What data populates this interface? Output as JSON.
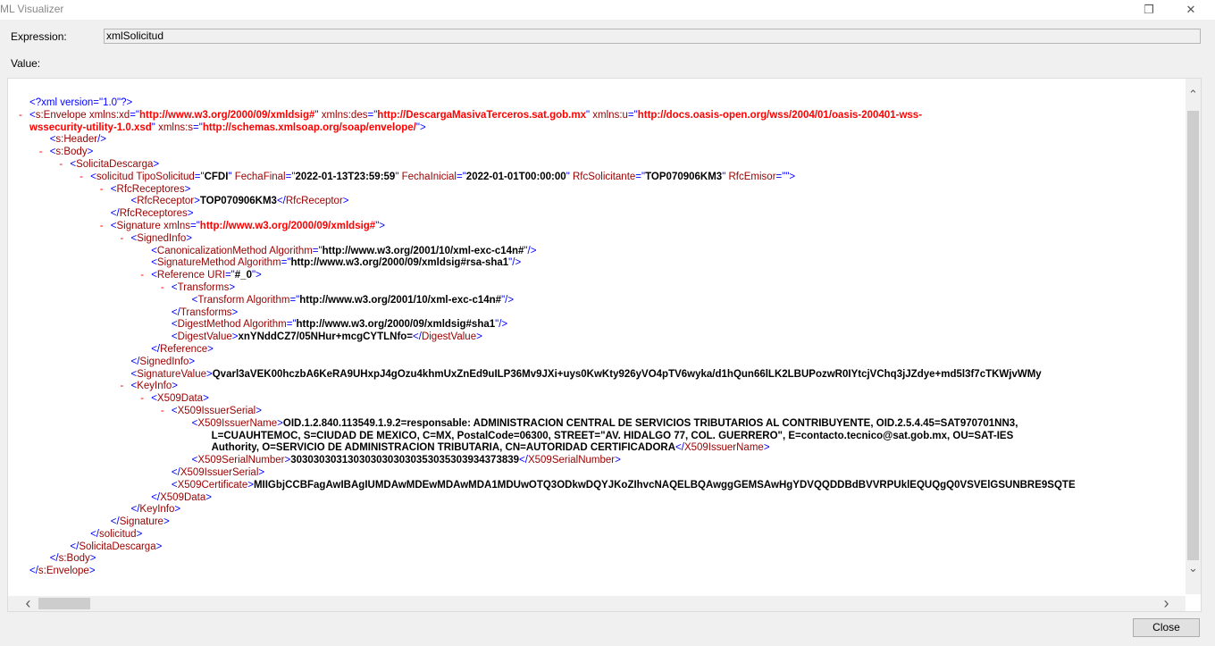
{
  "window": {
    "title": "ML Visualizer",
    "restore_glyph": "❐",
    "close_glyph": "✕"
  },
  "expression": {
    "label": "Expression:",
    "value": "xmlSolicitud"
  },
  "value_label": "Value:",
  "close_button": "Close",
  "xml_lines": [
    {
      "indent": 0,
      "minus": false,
      "parts": [
        [
          "t",
          "<?xml version=\"1.0\"?>"
        ]
      ]
    },
    {
      "indent": 0,
      "minus": true,
      "parts": [
        [
          "t",
          "<"
        ],
        [
          "n",
          "s:Envelope"
        ],
        [
          "a",
          " xmlns:xd"
        ],
        [
          "t",
          "=\""
        ],
        [
          "v",
          "http://www.w3.org/2000/09/xmldsig#"
        ],
        [
          "t",
          "\""
        ],
        [
          "a",
          " xmlns:des"
        ],
        [
          "t",
          "=\""
        ],
        [
          "v",
          "http://DescargaMasivaTerceros.sat.gob.mx"
        ],
        [
          "t",
          "\""
        ],
        [
          "a",
          " xmlns:u"
        ],
        [
          "t",
          "=\""
        ],
        [
          "v",
          "http://docs.oasis-open.org/wss/2004/01/oasis-200401-wss-"
        ]
      ]
    },
    {
      "indent": 0,
      "minus": false,
      "parts": [
        [
          "v",
          "wssecurity-utility-1.0.xsd"
        ],
        [
          "t",
          "\""
        ],
        [
          "a",
          " xmlns:s"
        ],
        [
          "t",
          "=\""
        ],
        [
          "v",
          "http://schemas.xmlsoap.org/soap/envelope/"
        ],
        [
          "t",
          "\">"
        ]
      ]
    },
    {
      "indent": 1,
      "minus": false,
      "parts": [
        [
          "t",
          "<"
        ],
        [
          "n",
          "s:Header"
        ],
        [
          "t",
          "/>"
        ]
      ]
    },
    {
      "indent": 1,
      "minus": true,
      "parts": [
        [
          "t",
          "<"
        ],
        [
          "n",
          "s:Body"
        ],
        [
          "t",
          ">"
        ]
      ]
    },
    {
      "indent": 2,
      "minus": true,
      "parts": [
        [
          "t",
          "<"
        ],
        [
          "n",
          "SolicitaDescarga"
        ],
        [
          "t",
          ">"
        ]
      ]
    },
    {
      "indent": 3,
      "minus": true,
      "parts": [
        [
          "t",
          "<"
        ],
        [
          "n",
          "solicitud"
        ],
        [
          "a",
          " TipoSolicitud"
        ],
        [
          "t",
          "=\""
        ],
        [
          "k",
          "CFDI"
        ],
        [
          "t",
          "\""
        ],
        [
          "a",
          " FechaFinal"
        ],
        [
          "t",
          "=\""
        ],
        [
          "k",
          "2022-01-13T23:59:59"
        ],
        [
          "t",
          "\""
        ],
        [
          "a",
          " FechaInicial"
        ],
        [
          "t",
          "=\""
        ],
        [
          "k",
          "2022-01-01T00:00:00"
        ],
        [
          "t",
          "\""
        ],
        [
          "a",
          " RfcSolicitante"
        ],
        [
          "t",
          "=\""
        ],
        [
          "k",
          "TOP070906KM3"
        ],
        [
          "t",
          "\""
        ],
        [
          "a",
          " RfcEmisor"
        ],
        [
          "t",
          "=\"\">"
        ]
      ]
    },
    {
      "indent": 4,
      "minus": true,
      "parts": [
        [
          "t",
          "<"
        ],
        [
          "n",
          "RfcReceptores"
        ],
        [
          "t",
          ">"
        ]
      ]
    },
    {
      "indent": 5,
      "minus": false,
      "parts": [
        [
          "t",
          "<"
        ],
        [
          "n",
          "RfcReceptor"
        ],
        [
          "t",
          ">"
        ],
        [
          "k",
          "TOP070906KM3"
        ],
        [
          "t",
          "</"
        ],
        [
          "n",
          "RfcReceptor"
        ],
        [
          "t",
          ">"
        ]
      ]
    },
    {
      "indent": 4,
      "minus": false,
      "parts": [
        [
          "t",
          "</"
        ],
        [
          "n",
          "RfcReceptores"
        ],
        [
          "t",
          ">"
        ]
      ]
    },
    {
      "indent": 4,
      "minus": true,
      "parts": [
        [
          "t",
          "<"
        ],
        [
          "n",
          "Signature"
        ],
        [
          "a",
          " xmlns"
        ],
        [
          "t",
          "=\""
        ],
        [
          "v",
          "http://www.w3.org/2000/09/xmldsig#"
        ],
        [
          "t",
          "\">"
        ]
      ]
    },
    {
      "indent": 5,
      "minus": true,
      "parts": [
        [
          "t",
          "<"
        ],
        [
          "n",
          "SignedInfo"
        ],
        [
          "t",
          ">"
        ]
      ]
    },
    {
      "indent": 6,
      "minus": false,
      "parts": [
        [
          "t",
          "<"
        ],
        [
          "n",
          "CanonicalizationMethod"
        ],
        [
          "a",
          " Algorithm"
        ],
        [
          "t",
          "=\""
        ],
        [
          "k",
          "http://www.w3.org/2001/10/xml-exc-c14n#"
        ],
        [
          "t",
          "\"/>"
        ]
      ]
    },
    {
      "indent": 6,
      "minus": false,
      "parts": [
        [
          "t",
          "<"
        ],
        [
          "n",
          "SignatureMethod"
        ],
        [
          "a",
          " Algorithm"
        ],
        [
          "t",
          "=\""
        ],
        [
          "k",
          "http://www.w3.org/2000/09/xmldsig#rsa-sha1"
        ],
        [
          "t",
          "\"/>"
        ]
      ]
    },
    {
      "indent": 6,
      "minus": true,
      "parts": [
        [
          "t",
          "<"
        ],
        [
          "n",
          "Reference"
        ],
        [
          "a",
          " URI"
        ],
        [
          "t",
          "=\""
        ],
        [
          "k",
          "#_0"
        ],
        [
          "t",
          "\">"
        ]
      ]
    },
    {
      "indent": 7,
      "minus": true,
      "parts": [
        [
          "t",
          "<"
        ],
        [
          "n",
          "Transforms"
        ],
        [
          "t",
          ">"
        ]
      ]
    },
    {
      "indent": 8,
      "minus": false,
      "parts": [
        [
          "t",
          "<"
        ],
        [
          "n",
          "Transform"
        ],
        [
          "a",
          " Algorithm"
        ],
        [
          "t",
          "=\""
        ],
        [
          "k",
          "http://www.w3.org/2001/10/xml-exc-c14n#"
        ],
        [
          "t",
          "\"/>"
        ]
      ]
    },
    {
      "indent": 7,
      "minus": false,
      "parts": [
        [
          "t",
          "</"
        ],
        [
          "n",
          "Transforms"
        ],
        [
          "t",
          ">"
        ]
      ]
    },
    {
      "indent": 7,
      "minus": false,
      "parts": [
        [
          "t",
          "<"
        ],
        [
          "n",
          "DigestMethod"
        ],
        [
          "a",
          " Algorithm"
        ],
        [
          "t",
          "=\""
        ],
        [
          "k",
          "http://www.w3.org/2000/09/xmldsig#sha1"
        ],
        [
          "t",
          "\"/>"
        ]
      ]
    },
    {
      "indent": 7,
      "minus": false,
      "parts": [
        [
          "t",
          "<"
        ],
        [
          "n",
          "DigestValue"
        ],
        [
          "t",
          ">"
        ],
        [
          "k",
          "xnYNddCZ7/05NHur+mcgCYTLNfo="
        ],
        [
          "t",
          "</"
        ],
        [
          "n",
          "DigestValue"
        ],
        [
          "t",
          ">"
        ]
      ]
    },
    {
      "indent": 6,
      "minus": false,
      "parts": [
        [
          "t",
          "</"
        ],
        [
          "n",
          "Reference"
        ],
        [
          "t",
          ">"
        ]
      ]
    },
    {
      "indent": 5,
      "minus": false,
      "parts": [
        [
          "t",
          "</"
        ],
        [
          "n",
          "SignedInfo"
        ],
        [
          "t",
          ">"
        ]
      ]
    },
    {
      "indent": 5,
      "minus": false,
      "parts": [
        [
          "t",
          "<"
        ],
        [
          "n",
          "SignatureValue"
        ],
        [
          "t",
          ">"
        ],
        [
          "k",
          "Qvarl3aVEK00hczbA6KeRA9UHxpJ4gOzu4khmUxZnEd9uILP36Mv9JXi+uys0KwKty926yVO4pTV6wyka/d1hQun66lLK2LBUPozwR0IYtcjVChq3jJZdye+md5l3f7cTKWjvWMy"
        ]
      ]
    },
    {
      "indent": 5,
      "minus": true,
      "parts": [
        [
          "t",
          "<"
        ],
        [
          "n",
          "KeyInfo"
        ],
        [
          "t",
          ">"
        ]
      ]
    },
    {
      "indent": 6,
      "minus": true,
      "parts": [
        [
          "t",
          "<"
        ],
        [
          "n",
          "X509Data"
        ],
        [
          "t",
          ">"
        ]
      ]
    },
    {
      "indent": 7,
      "minus": true,
      "parts": [
        [
          "t",
          "<"
        ],
        [
          "n",
          "X509IssuerSerial"
        ],
        [
          "t",
          ">"
        ]
      ]
    },
    {
      "indent": 8,
      "minus": false,
      "parts": [
        [
          "t",
          "<"
        ],
        [
          "n",
          "X509IssuerName"
        ],
        [
          "t",
          ">"
        ],
        [
          "k",
          "OID.1.2.840.113549.1.9.2=responsable: ADMINISTRACION CENTRAL DE SERVICIOS TRIBUTARIOS AL CONTRIBUYENTE, OID.2.5.4.45=SAT970701NN3,"
        ]
      ]
    },
    {
      "indent": 8,
      "minus": false,
      "pad": 1,
      "parts": [
        [
          "k",
          "L=CUAUHTEMOC, S=CIUDAD DE MEXICO, C=MX, PostalCode=06300, STREET=\"AV. HIDALGO 77, COL. GUERRERO\", E=contacto.tecnico@sat.gob.mx, OU=SAT-IES"
        ]
      ]
    },
    {
      "indent": 8,
      "minus": false,
      "pad": 1,
      "parts": [
        [
          "k",
          "Authority, O=SERVICIO DE ADMINISTRACION TRIBUTARIA, CN=AUTORIDAD CERTIFICADORA"
        ],
        [
          "t",
          "</"
        ],
        [
          "n",
          "X509IssuerName"
        ],
        [
          "t",
          ">"
        ]
      ]
    },
    {
      "indent": 8,
      "minus": false,
      "parts": [
        [
          "t",
          "<"
        ],
        [
          "n",
          "X509SerialNumber"
        ],
        [
          "t",
          ">"
        ],
        [
          "k",
          "3030303031303030303030353035303934373839"
        ],
        [
          "t",
          "</"
        ],
        [
          "n",
          "X509SerialNumber"
        ],
        [
          "t",
          ">"
        ]
      ]
    },
    {
      "indent": 7,
      "minus": false,
      "parts": [
        [
          "t",
          "</"
        ],
        [
          "n",
          "X509IssuerSerial"
        ],
        [
          "t",
          ">"
        ]
      ]
    },
    {
      "indent": 7,
      "minus": false,
      "parts": [
        [
          "t",
          "<"
        ],
        [
          "n",
          "X509Certificate"
        ],
        [
          "t",
          ">"
        ],
        [
          "k",
          "MIIGbjCCBFagAwIBAgIUMDAwMDEwMDAwMDA1MDUwOTQ3ODkwDQYJKoZIhvcNAQELBQAwggGEMSAwHgYDVQQDDBdBVVRPUklEQUQgQ0VSVElGSUNBRE9SQTE"
        ]
      ]
    },
    {
      "indent": 6,
      "minus": false,
      "parts": [
        [
          "t",
          "</"
        ],
        [
          "n",
          "X509Data"
        ],
        [
          "t",
          ">"
        ]
      ]
    },
    {
      "indent": 5,
      "minus": false,
      "parts": [
        [
          "t",
          "</"
        ],
        [
          "n",
          "KeyInfo"
        ],
        [
          "t",
          ">"
        ]
      ]
    },
    {
      "indent": 4,
      "minus": false,
      "parts": [
        [
          "t",
          "</"
        ],
        [
          "n",
          "Signature"
        ],
        [
          "t",
          ">"
        ]
      ]
    },
    {
      "indent": 3,
      "minus": false,
      "parts": [
        [
          "t",
          "</"
        ],
        [
          "n",
          "solicitud"
        ],
        [
          "t",
          ">"
        ]
      ]
    },
    {
      "indent": 2,
      "minus": false,
      "parts": [
        [
          "t",
          "</"
        ],
        [
          "n",
          "SolicitaDescarga"
        ],
        [
          "t",
          ">"
        ]
      ]
    },
    {
      "indent": 1,
      "minus": false,
      "parts": [
        [
          "t",
          "</"
        ],
        [
          "n",
          "s:Body"
        ],
        [
          "t",
          ">"
        ]
      ]
    },
    {
      "indent": 0,
      "minus": false,
      "parts": [
        [
          "t",
          "</"
        ],
        [
          "n",
          "s:Envelope"
        ],
        [
          "t",
          ">"
        ]
      ]
    }
  ],
  "scroll": {
    "up": "⌃",
    "down": "⌄",
    "left": "‹",
    "right": "›"
  }
}
